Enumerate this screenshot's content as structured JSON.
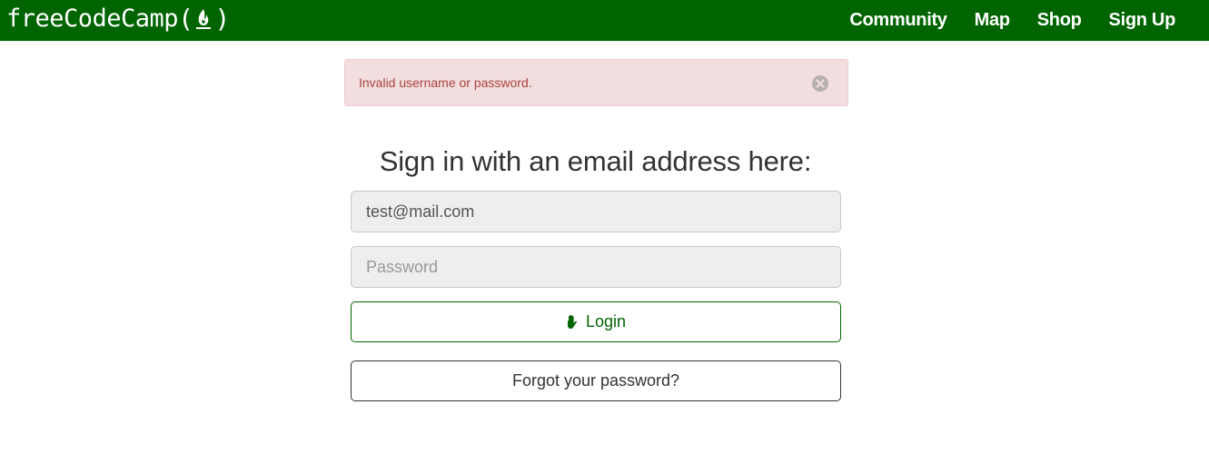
{
  "navbar": {
    "brand": {
      "text": "freeCodeCamp",
      "paren_open": "(",
      "paren_close": ")"
    },
    "links": [
      "Community",
      "Map",
      "Shop",
      "Sign Up"
    ],
    "background": "#006400"
  },
  "alert": {
    "message": "Invalid username or password.",
    "close_icon": "close-circle-icon",
    "background": "#f2dede"
  },
  "form": {
    "title": "Sign in with an email address here:",
    "email_value": "test@mail.com",
    "password_placeholder": "Password",
    "login_icon": "hand-icon",
    "login_label": "Login",
    "forgot_label": "Forgot your password?"
  }
}
